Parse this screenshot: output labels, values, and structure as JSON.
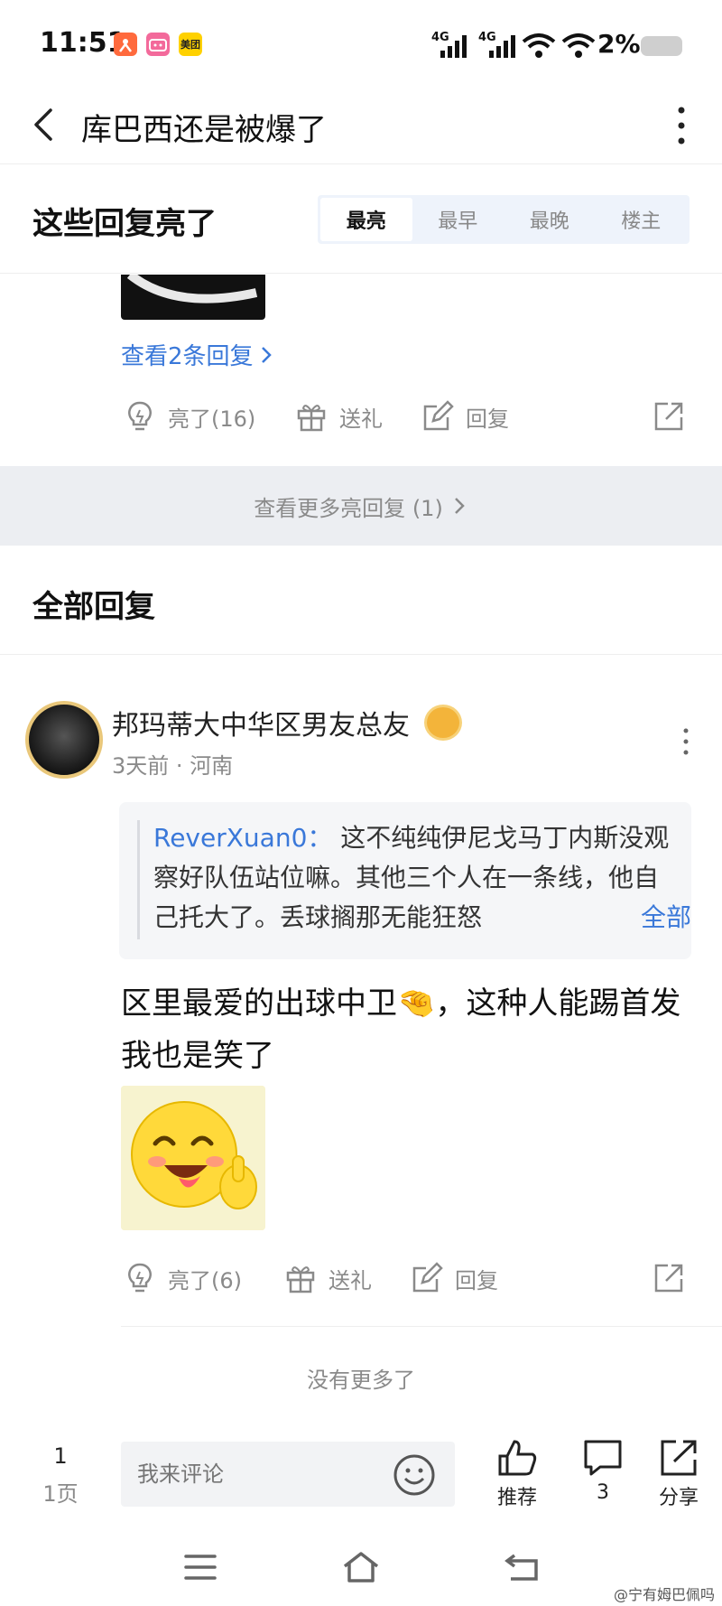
{
  "status_bar": {
    "time": "11:51",
    "apps": [
      "dianping-icon",
      "bilibili-icon",
      "meituan-icon"
    ],
    "meituan_label": "美团",
    "network_1": "4G",
    "network_2": "4G",
    "battery": "2%"
  },
  "header": {
    "title": "库巴西还是被爆了"
  },
  "hot_replies": {
    "title": "这些回复亮了",
    "sort_tabs": [
      "最亮",
      "最早",
      "最晚",
      "楼主"
    ],
    "active_tab": "最亮",
    "view_replies": "查看2条回复",
    "actions": {
      "like": "亮了(16)",
      "gift": "送礼",
      "reply": "回复"
    },
    "more": "查看更多亮回复 (1)"
  },
  "all_replies": {
    "title": "全部回复",
    "comment": {
      "username": "邦玛蒂大中华区男友总友",
      "time": "3天前",
      "location": "河南",
      "quote_user": "ReverXuan0：",
      "quote_text": "这不纯纯伊尼戈马丁内斯没观察好队伍站位嘛。其他三个人在一条线，他自己托大了。丢球搁那无能狂怒",
      "quote_more": "全部",
      "text": "区里最爱的出球中卫🤏，这种人能踢首发我也是笑了",
      "actions": {
        "like": "亮了(6)",
        "gift": "送礼",
        "reply": "回复"
      }
    },
    "no_more": "没有更多了"
  },
  "bottom_bar": {
    "page": "1",
    "page_label": "1页",
    "input_placeholder": "我来评论",
    "recommend": "推荐",
    "comment_count": "3",
    "share": "分享"
  },
  "watermark": "@宁有姆巴佩吗",
  "colors": {
    "link_blue": "#3a78d9",
    "gray_text": "#8a8a8a",
    "band_bg": "#eceef2"
  }
}
